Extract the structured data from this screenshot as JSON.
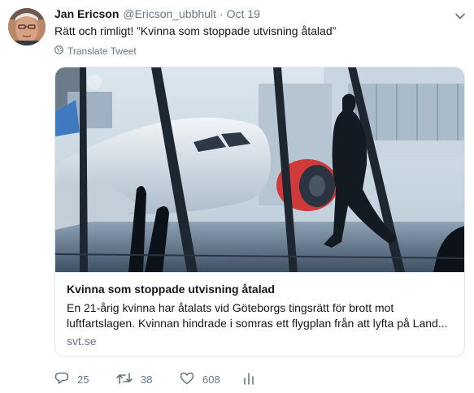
{
  "author": {
    "name": "Jan Ericson",
    "handle": "@Ericson_ubbhult",
    "separator": "·",
    "date": "Oct 19"
  },
  "tweet": {
    "text": "Rätt och rimligt! ”Kvinna som stoppade utvisning åtalad”",
    "translate_label": "Translate Tweet"
  },
  "card": {
    "title": "Kvinna som stoppade utvisning åtalad",
    "description": "En 21-årig kvinna har åtalats vid Göteborgs tingsrätt för brott mot luftfartslagen. Kvinnan hindrade i somras ett flygplan från att lyfta på Land...",
    "domain": "svt.se"
  },
  "actions": {
    "reply_count": "25",
    "retweet_count": "38",
    "like_count": "608"
  },
  "colors": {
    "text": "#14171a",
    "secondary": "#657786",
    "border": "#e1e8ed",
    "engine_red": "#d13a3a"
  },
  "icons": [
    "caret-down-icon",
    "globe-icon",
    "reply-icon",
    "retweet-icon",
    "like-icon",
    "analytics-icon"
  ]
}
